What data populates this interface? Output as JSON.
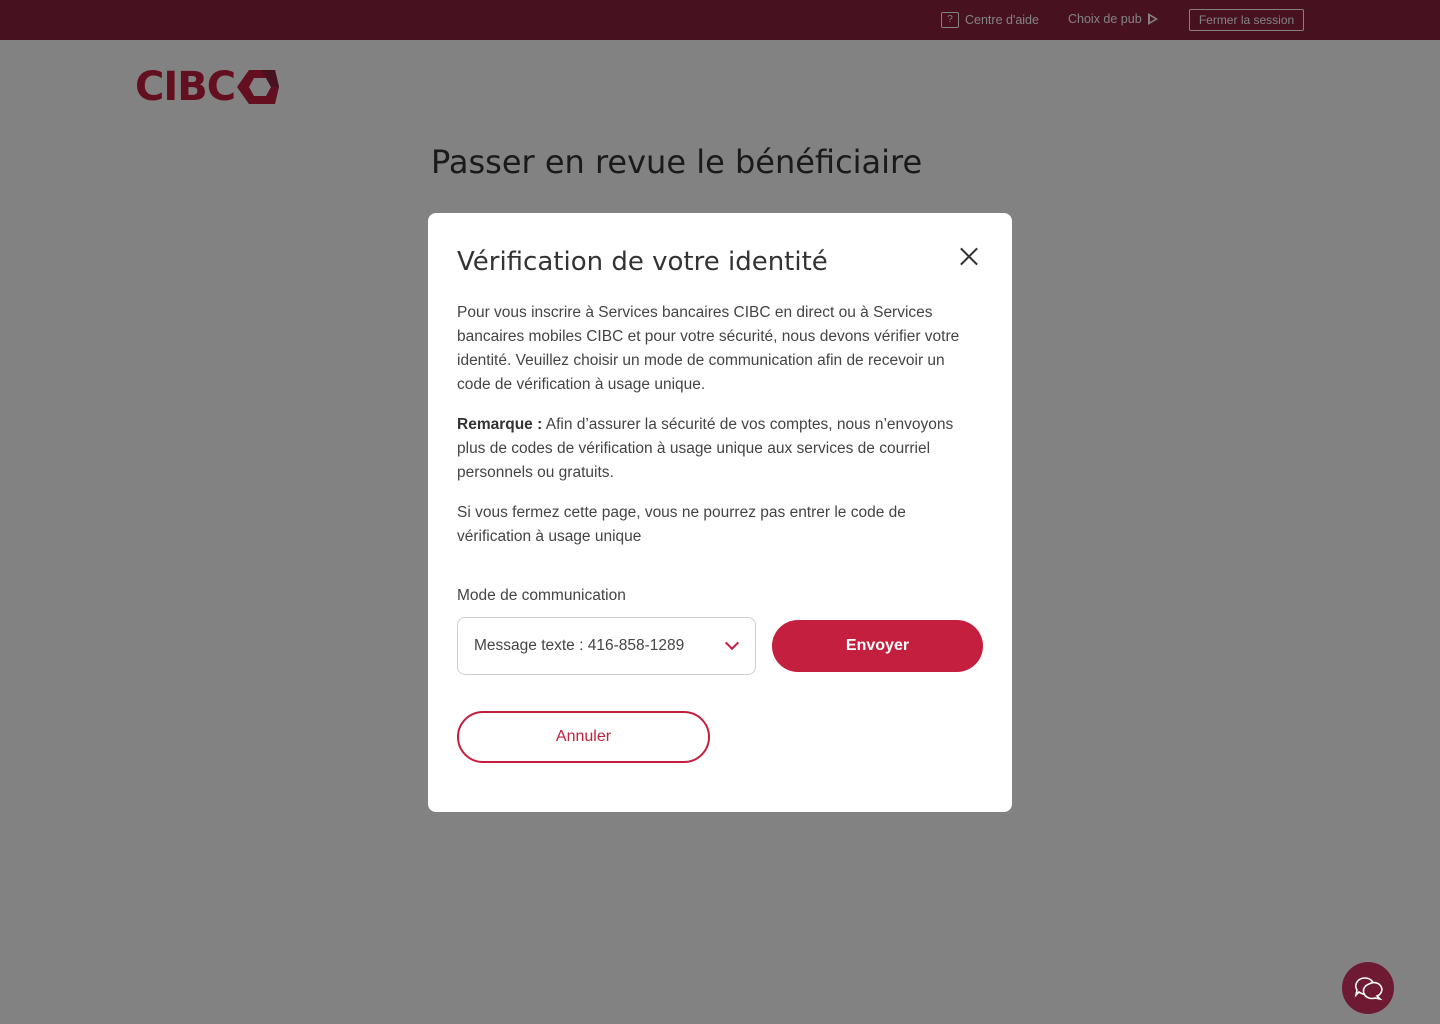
{
  "topbar": {
    "help_label": "Centre d'aide",
    "help_icon": "?",
    "adchoices_label": "Choix de pub",
    "logout_label": "Fermer la session"
  },
  "logo": {
    "text": "CIBC"
  },
  "page": {
    "title": "Passer en revue le bénéficiaire"
  },
  "modal": {
    "title": "Vérification de votre identité",
    "paragraph1": "Pour vous inscrire à Services bancaires CIBC en direct ou à Services bancaires mobiles CIBC et pour votre sécurité, nous devons vérifier votre identité. Veuillez choisir un mode de communication afin de recevoir un code de vérification à usage unique.",
    "note_label": "Remarque :",
    "note_text": " Afin d’assurer la sécurité de vos comptes, nous n’envoyons plus de codes de vérification à usage unique aux services de courriel personnels ou gratuits.",
    "paragraph3": "Si vous fermez cette page, vous ne pourrez pas entrer le code de vérification à usage unique",
    "field_label": "Mode de communication",
    "selected_option": "Message texte : 416-858-1289",
    "send_label": "Envoyer",
    "cancel_label": "Annuler"
  },
  "colors": {
    "brand_red": "#c41f3e",
    "topbar": "#8c2240"
  }
}
